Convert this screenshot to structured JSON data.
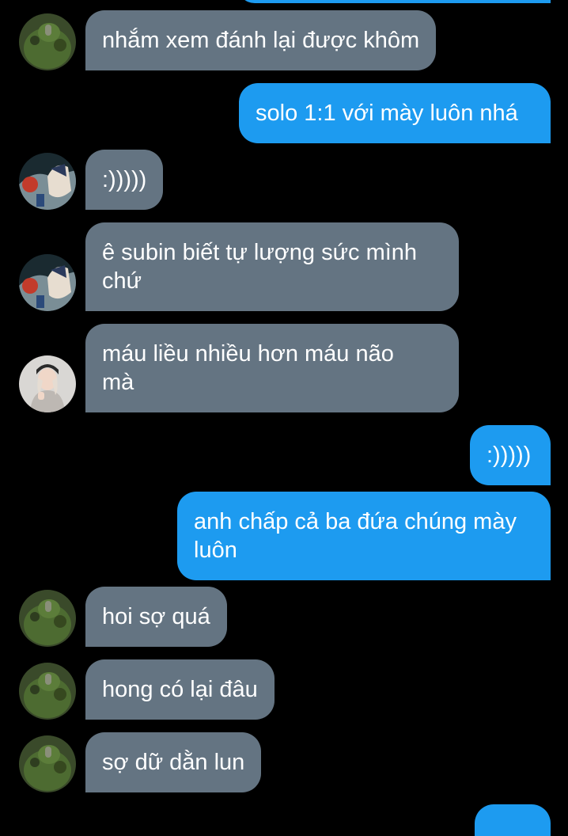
{
  "messages": [
    {
      "side": "out",
      "lines": [
        ""
      ]
    },
    {
      "side": "in",
      "avatar": "hulk-avatar-icon",
      "lines": [
        "nhắm xem đánh lại được khôm"
      ]
    },
    {
      "side": "out",
      "lines": [
        "solo 1:1 với mày luôn nhá"
      ]
    },
    {
      "side": "in",
      "avatar": "anime-avatar-icon",
      "lines": [
        ":)))))"
      ]
    },
    {
      "side": "in",
      "avatar": "anime-avatar-icon",
      "lines": [
        "ê subin biết tự lượng sức mình",
        "chứ"
      ]
    },
    {
      "side": "in",
      "avatar": "photo-avatar-icon",
      "lines": [
        "máu liều nhiều hơn máu não",
        "mà"
      ]
    },
    {
      "side": "out",
      "lines": [
        ":)))))"
      ]
    },
    {
      "side": "out",
      "lines": [
        "anh chấp cả ba đứa chúng mày",
        "luôn"
      ]
    },
    {
      "side": "in",
      "avatar": "hulk-avatar-icon",
      "lines": [
        "hoi sợ quá"
      ]
    },
    {
      "side": "in",
      "avatar": "hulk-avatar-icon",
      "lines": [
        "hong có lại đâu"
      ]
    },
    {
      "side": "in",
      "avatar": "hulk-avatar-icon",
      "lines": [
        "sợ dữ dằn lun"
      ]
    },
    {
      "side": "out",
      "lines": [
        ""
      ]
    }
  ],
  "colors": {
    "background": "#000000",
    "incoming_bubble": "#647482",
    "outgoing_bubble": "#1d9bf0",
    "text": "#ffffff"
  }
}
